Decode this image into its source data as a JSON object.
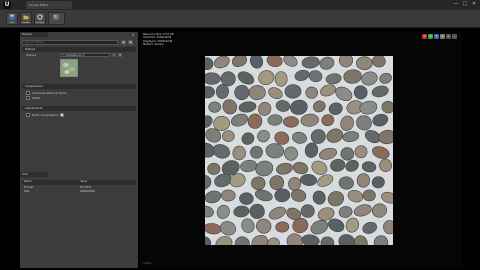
{
  "app": {
    "logo": "U",
    "window_title": "Unreal Editor"
  },
  "window_controls": {
    "minimize": "—",
    "maximize": "□",
    "close": "✕"
  },
  "toolbar": {
    "buttons": [
      {
        "label": "Save",
        "icon": "save-icon"
      },
      {
        "label": "Browse",
        "icon": "folder-icon"
      },
      {
        "label": "Reimport",
        "icon": "reimport-icon"
      },
      {
        "label": "",
        "icon": "texture-icon"
      }
    ]
  },
  "details_panel": {
    "tab_label": "Details",
    "close": "x",
    "search_placeholder": "Search Details",
    "section_texture": "Texture",
    "thumb_row_label": "Texture",
    "thumb_row_value": "T_Cobblestone_D",
    "section_compression": "Compression",
    "section_adjustments": "Adjustments",
    "checkbox_rows": [
      "Compress Without Alpha",
      "sRGB",
      "Defer Compression"
    ]
  },
  "info_panel": {
    "tab_label": "Info",
    "headers": [
      "Name",
      "Value"
    ],
    "rows": [
      {
        "name": "Format",
        "value": "PF_DXT1"
      },
      {
        "name": "Size",
        "value": "2048x2048"
      }
    ]
  },
  "viewport": {
    "lines": [
      "Resource Size: 2731 KB",
      "Imported: 2048x2048",
      "Displayed: 2048x2048",
      "Method: Stream"
    ],
    "corner_label": "100%",
    "buttons": [
      {
        "label": "R",
        "color": "#b33"
      },
      {
        "label": "G",
        "color": "#3a3"
      },
      {
        "label": "B",
        "color": "#36b"
      },
      {
        "label": "A",
        "color": "#777"
      },
      {
        "label": "+",
        "color": "#555"
      },
      {
        "label": "-",
        "color": "#555"
      }
    ]
  },
  "colors": {
    "accent": "#4a6cc8",
    "panel": "#3c3c3c",
    "viewport_bg": "#050505"
  }
}
